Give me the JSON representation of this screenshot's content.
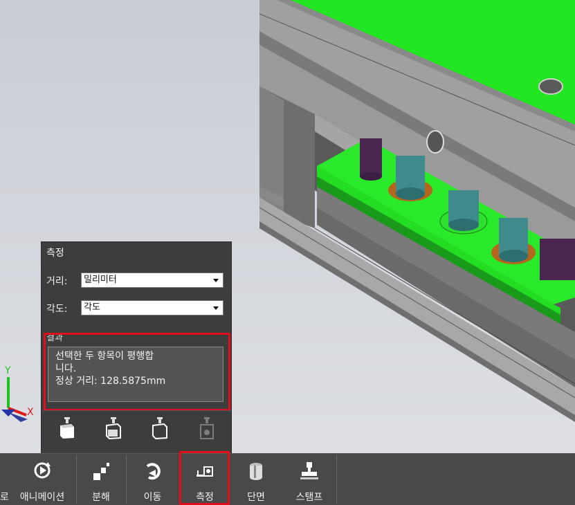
{
  "viewport": {
    "axis": {
      "y_label": "Y",
      "x_label": "X"
    },
    "colors": {
      "green_plate": "#22e622",
      "steel": "#8f8f8f",
      "pin_teal": "#3e8a8c",
      "pin_purple": "#4a2550"
    }
  },
  "measure_panel": {
    "title": "측정",
    "distance_label": "거리:",
    "distance_value": "밀리미터",
    "angle_label": "각도:",
    "angle_value": "각도",
    "result_label": "결과",
    "result_line1": "선택한 두 항목이 평행합",
    "result_line2": "니다.",
    "result_line3": "정상 거리: 128.5875mm",
    "tools": [
      "measure-tool-1-icon",
      "measure-tool-2-icon",
      "measure-tool-3-icon",
      "measure-tool-4-icon"
    ],
    "highlight_color": "#e0101a"
  },
  "toolbar": {
    "items": [
      {
        "label": "로",
        "icon": "partial-icon"
      },
      {
        "label": "애니메이션",
        "icon": "animation-icon"
      },
      {
        "label": "분해",
        "icon": "explode-icon"
      },
      {
        "label": "이동",
        "icon": "move-icon"
      },
      {
        "label": "측정",
        "icon": "measure-icon",
        "active": true
      },
      {
        "label": "단면",
        "icon": "section-icon"
      },
      {
        "label": "스탬프",
        "icon": "stamp-icon"
      }
    ]
  }
}
